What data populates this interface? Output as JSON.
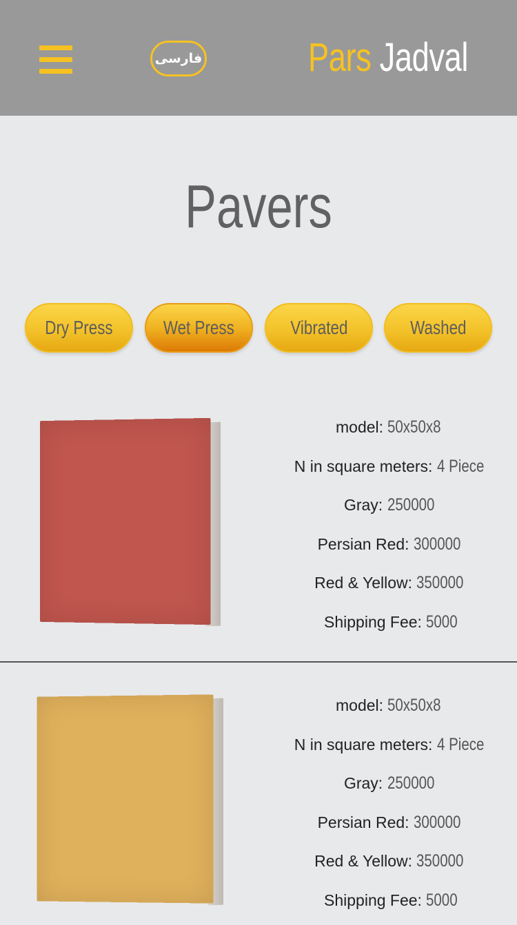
{
  "header": {
    "lang_label": "فارسی",
    "logo_word1": "Pars",
    "logo_word2": "Jadval",
    "menu_icon": "hamburger-icon"
  },
  "page": {
    "title": "Pavers"
  },
  "tabs": [
    {
      "label": "Dry Press",
      "active": false
    },
    {
      "label": "Wet Press",
      "active": true
    },
    {
      "label": "Vibrated",
      "active": false
    },
    {
      "label": "Washed",
      "active": false
    }
  ],
  "products": [
    {
      "tile_color": "#c0564e",
      "specs": [
        {
          "label": "model:",
          "value": "50x50x8"
        },
        {
          "label": "N in square meters:",
          "value": "4 Piece"
        },
        {
          "label": "Gray:",
          "value": "250000"
        },
        {
          "label": "Persian Red:",
          "value": "300000"
        },
        {
          "label": "Red & Yellow:",
          "value": "350000"
        },
        {
          "label": "Shipping Fee:",
          "value": "5000"
        }
      ]
    },
    {
      "tile_color": "#e0b15c",
      "specs": [
        {
          "label": "model:",
          "value": "50x50x8"
        },
        {
          "label": "N in square meters:",
          "value": "4 Piece"
        },
        {
          "label": "Gray:",
          "value": "250000"
        },
        {
          "label": "Persian Red:",
          "value": "300000"
        },
        {
          "label": "Red & Yellow:",
          "value": "350000"
        },
        {
          "label": "Shipping Fee:",
          "value": "5000"
        }
      ]
    }
  ],
  "colors": {
    "accent": "#f6c222",
    "header_bg": "#999999",
    "page_bg": "#e8e9eb"
  }
}
